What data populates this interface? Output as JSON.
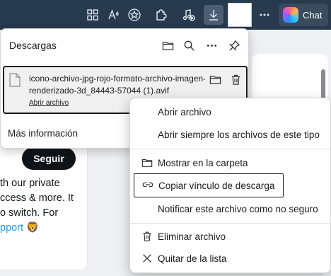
{
  "toolbar": {
    "icons": [
      "apps-icon",
      "read-aloud-icon",
      "favorite-star-icon",
      "extensions-icon",
      "media-control-icon",
      "download-icon",
      "profile-box",
      "more-icon"
    ],
    "copilot_label": "Chat"
  },
  "page": {
    "follow_label": "Seguir",
    "lines": [
      "th our private",
      "ccess & more. It",
      "o switch. For",
      "pport 🦁"
    ]
  },
  "downloads": {
    "title": "Descargas",
    "header_icons": [
      "folder-icon",
      "search-icon",
      "more-icon",
      "pin-icon"
    ],
    "item": {
      "file_name_line1": "icono-archivo-jpg-rojo-formato-archivo-imagen-",
      "file_name_line2": "renderizado-3d_84443-57044 (1).avif",
      "open_link": "Abrir archivo",
      "actions": [
        "folder-icon",
        "trash-icon"
      ]
    },
    "more_info": "Más información"
  },
  "context_menu": {
    "items": [
      {
        "label": "Abrir archivo",
        "icon": ""
      },
      {
        "label": "Abrir siempre los archivos de este tipo",
        "icon": ""
      },
      {
        "label": "Mostrar en la carpeta",
        "icon": "folder-icon"
      },
      {
        "label": "Copiar vínculo de descarga",
        "icon": "link-icon"
      },
      {
        "label": "Notificar este archivo como no seguro",
        "icon": ""
      },
      {
        "label": "Eliminar archivo",
        "icon": "trash-icon"
      },
      {
        "label": "Quitar de la lista",
        "icon": "close-icon"
      }
    ],
    "focused_index": 3
  },
  "colors": {
    "toolbar_bg": "#273a4e",
    "focus_border": "#1a1a1a",
    "link_blue": "#1d9bf0"
  }
}
